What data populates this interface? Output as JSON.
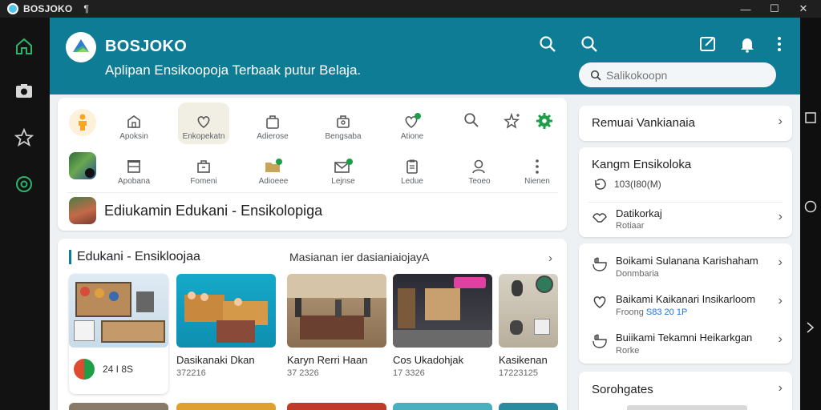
{
  "window": {
    "title": "BOSJOKO",
    "pin_glyph": "¶",
    "controls": {
      "minimize": "—",
      "maximize": "☐",
      "close": "✕"
    }
  },
  "rail": {
    "items": [
      {
        "icon": "home-icon"
      },
      {
        "icon": "camera-icon"
      },
      {
        "icon": "star-outline-icon"
      },
      {
        "icon": "chat-icon"
      }
    ]
  },
  "header": {
    "brand": "BOSJOKO",
    "tagline": "Aplipan Ensikoopoja Terbaak putur Belaja.",
    "search": {
      "placeholder": "Salikokoopn"
    }
  },
  "quick_access": {
    "row1": [
      {
        "label": "Apoksin",
        "icon": "book-icon"
      },
      {
        "label": "Enkopekatn",
        "icon": "heart-hand-icon",
        "selected": true
      },
      {
        "label": "Adierose",
        "icon": "bag-icon"
      },
      {
        "label": "Bengsaba",
        "icon": "briefcase-icon"
      },
      {
        "label": "Atione",
        "icon": "heart-badge-icon"
      }
    ],
    "row2": [
      {
        "label": "Apobana",
        "icon": "dresser-icon"
      },
      {
        "label": "Fomeni",
        "icon": "box-icon"
      },
      {
        "label": "Adioeee",
        "icon": "folder-icon"
      },
      {
        "label": "Lejnse",
        "icon": "mail-icon"
      },
      {
        "label": "Ledue",
        "icon": "clipboard-icon"
      },
      {
        "label": "Teoeo",
        "icon": "person-search-icon"
      },
      {
        "label": "Nienen",
        "icon": "more-vertical-icon"
      }
    ],
    "banner_title": "Ediukamin Edukani - Ensikolopiga"
  },
  "featured": {
    "title": "Edukani - Ensikloojaa",
    "subtitle": "Masianan ier dasianiaiojayA",
    "tiles": [
      {
        "title": "",
        "meta": "24 I 8S"
      },
      {
        "title": "Dasikanaki Dkan",
        "meta": "372216"
      },
      {
        "title": "Karyn Rerri Haan",
        "meta": "37 2326"
      },
      {
        "title": "Cos Ukadohjak",
        "meta": "17 3326"
      },
      {
        "title": "Kasikenan",
        "meta": "17223125"
      }
    ]
  },
  "side": {
    "top_link": "Remuai Vankianaia",
    "info_card": {
      "title": "Kangm Ensikoloka",
      "count": "103(I80(M)",
      "row_title": "Datikorkaj",
      "row_sub": "Rotiaar"
    },
    "list": [
      {
        "title": "Boikami Sulanana Karishaham",
        "sub": "Donmbaria"
      },
      {
        "title": "Baikami Kaikanari Insikarloom",
        "sub_prefix": "Froong ",
        "sub_accent": "S83 20 1P"
      },
      {
        "title": "Buiikami Tekamni Heikarkgan",
        "sub": "Rorke"
      }
    ],
    "bottom_link": "Sorohgates"
  },
  "colors": {
    "header": "#0e7c95",
    "accent_green": "#1e9e48",
    "selected_bg": "#f1efe3"
  }
}
